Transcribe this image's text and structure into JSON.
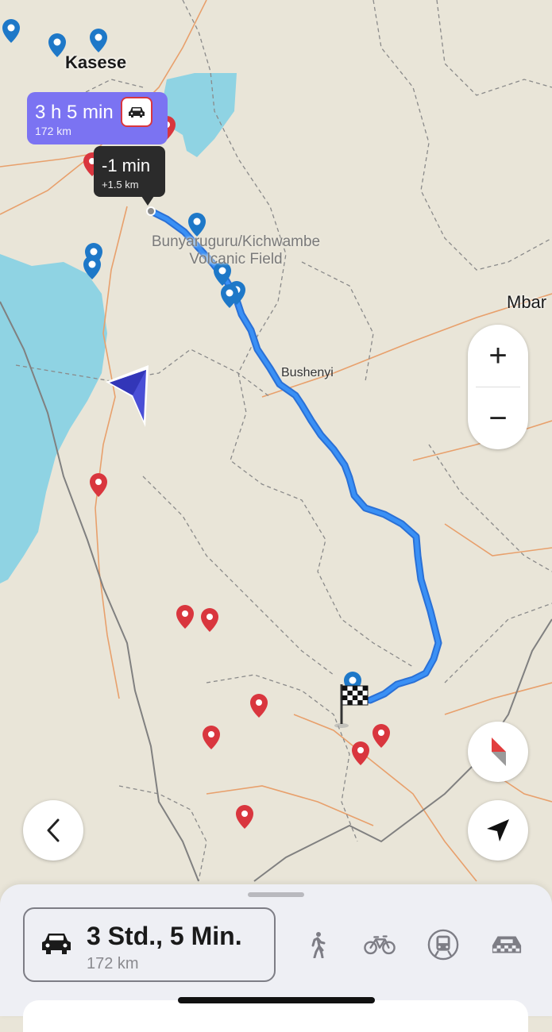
{
  "map": {
    "labels": {
      "kasese": "Kasese",
      "bunyaruguru_line1": "Bunyaruguru/Kichwambe",
      "bunyaruguru_line2": "Volcanic Field",
      "bushenyi": "Bushenyi",
      "mbarara_partial": "Mbar"
    },
    "colors": {
      "land": "#e9e5d8",
      "water": "#8fd3e3",
      "route": "#2f7fe6",
      "district_border": "#8a8a8a",
      "road": "#e8a06c",
      "pin_red": "#d9363e",
      "pin_blue": "#1e78c8"
    }
  },
  "route_card": {
    "time": "3 h 5 min",
    "distance": "172 km",
    "mode_icon": "car-icon"
  },
  "alt_route_card": {
    "time_diff": "-1 min",
    "distance_diff": "+1.5 km"
  },
  "controls": {
    "zoom_in": "+",
    "zoom_out": "−",
    "back_icon": "chevron-left-icon",
    "compass_icon": "compass-icon",
    "locate_icon": "navigation-arrow-icon"
  },
  "bottom_sheet": {
    "selected_mode": {
      "icon": "car-icon",
      "time": "3 Std., 5 Min.",
      "distance": "172 km"
    },
    "other_modes": [
      "walk-icon",
      "bicycle-icon",
      "public-transport-icon",
      "taxi-icon"
    ]
  }
}
